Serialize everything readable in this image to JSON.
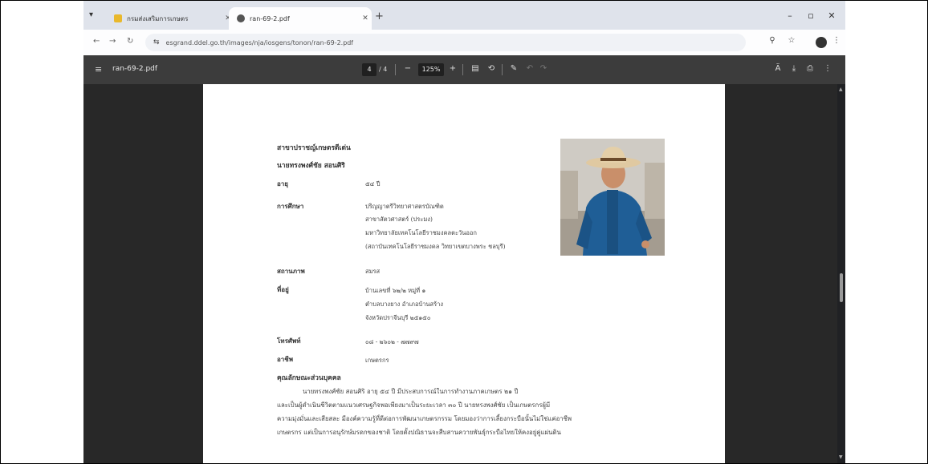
{
  "browser": {
    "tabs": [
      {
        "title": "กรมส่งเสริมการเกษตร",
        "favicon_color": "#e9b82c"
      },
      {
        "title": "ran-69-2.pdf",
        "favicon_color": "#555555"
      }
    ],
    "url": "esgrand.ddel.go.th/images/nja/iosgens/tonon/ran-69-2.pdf"
  },
  "pdf": {
    "filename": "ran-69-2.pdf",
    "page_current": "4",
    "page_total": "/ 4",
    "zoom": "125%"
  },
  "doc": {
    "section_title": "สาขาปราชญ์เกษตรดีเด่น",
    "person_name": "นายทรงพงศ์ชัย สอนศิริ",
    "fields": [
      {
        "label": "อายุ",
        "lines": [
          "๕๔ ปี"
        ]
      },
      {
        "label": "การศึกษา",
        "lines": [
          "ปริญญาตรีวิทยาศาสตรบัณฑิต",
          "สาขาสัตวศาสตร์ (ประมง)",
          "มหาวิทยาลัยเทคโนโลยีราชมงคลตะวันออก",
          "(สถาบันเทคโนโลยีราชมงคล วิทยาเขตบางพระ ชลบุรี)"
        ]
      },
      {
        "label": "สถานภาพ",
        "lines": [
          "สมรส"
        ]
      },
      {
        "label": "ที่อยู่",
        "lines": [
          "บ้านเลขที่ ๖๒/๒ หมู่ที่ ๑",
          "ตำบลบางยาง อำเภอบ้านสร้าง",
          "จังหวัดปราจีนบุรี ๒๕๑๕๐"
        ]
      },
      {
        "label": "โทรศัพท์",
        "lines": [
          "๐๘ - ๒๖๐๒ - ๗๗๙๗"
        ]
      },
      {
        "label": "อาชีพ",
        "lines": [
          "เกษตรกร"
        ]
      }
    ],
    "traits_heading": "คุณลักษณะส่วนบุคคล",
    "paragraph": [
      "นายทรงพงศ์ชัย สอนศิริ อายุ ๕๔ ปี มีประสบการณ์ในการทำงานภาคเกษตร ๒๑ ปี",
      "และเป็นผู้ดำเนินชีวิตตามแนวเศรษฐกิจพอเพียงมาเป็นระยะเวลา ๓๐ ปี นายทรงพงศ์ชัย เป็นเกษตรกรผู้มี",
      "ความมุ่งมั่นและเสียสละ มีองค์ความรู้ที่ดีต่อการพัฒนาเกษตรกรรม โดยมองว่าการเลี้ยงกระบือนั้นไม่ใช่แค่อาชีพ",
      "เกษตรกร แต่เป็นการอนุรักษ์มรดกของชาติ โดยตั้งปณิธานจะสืบสานควายพันธุ์กระบือไทยให้คงอยู่คู่แผ่นดิน"
    ]
  }
}
